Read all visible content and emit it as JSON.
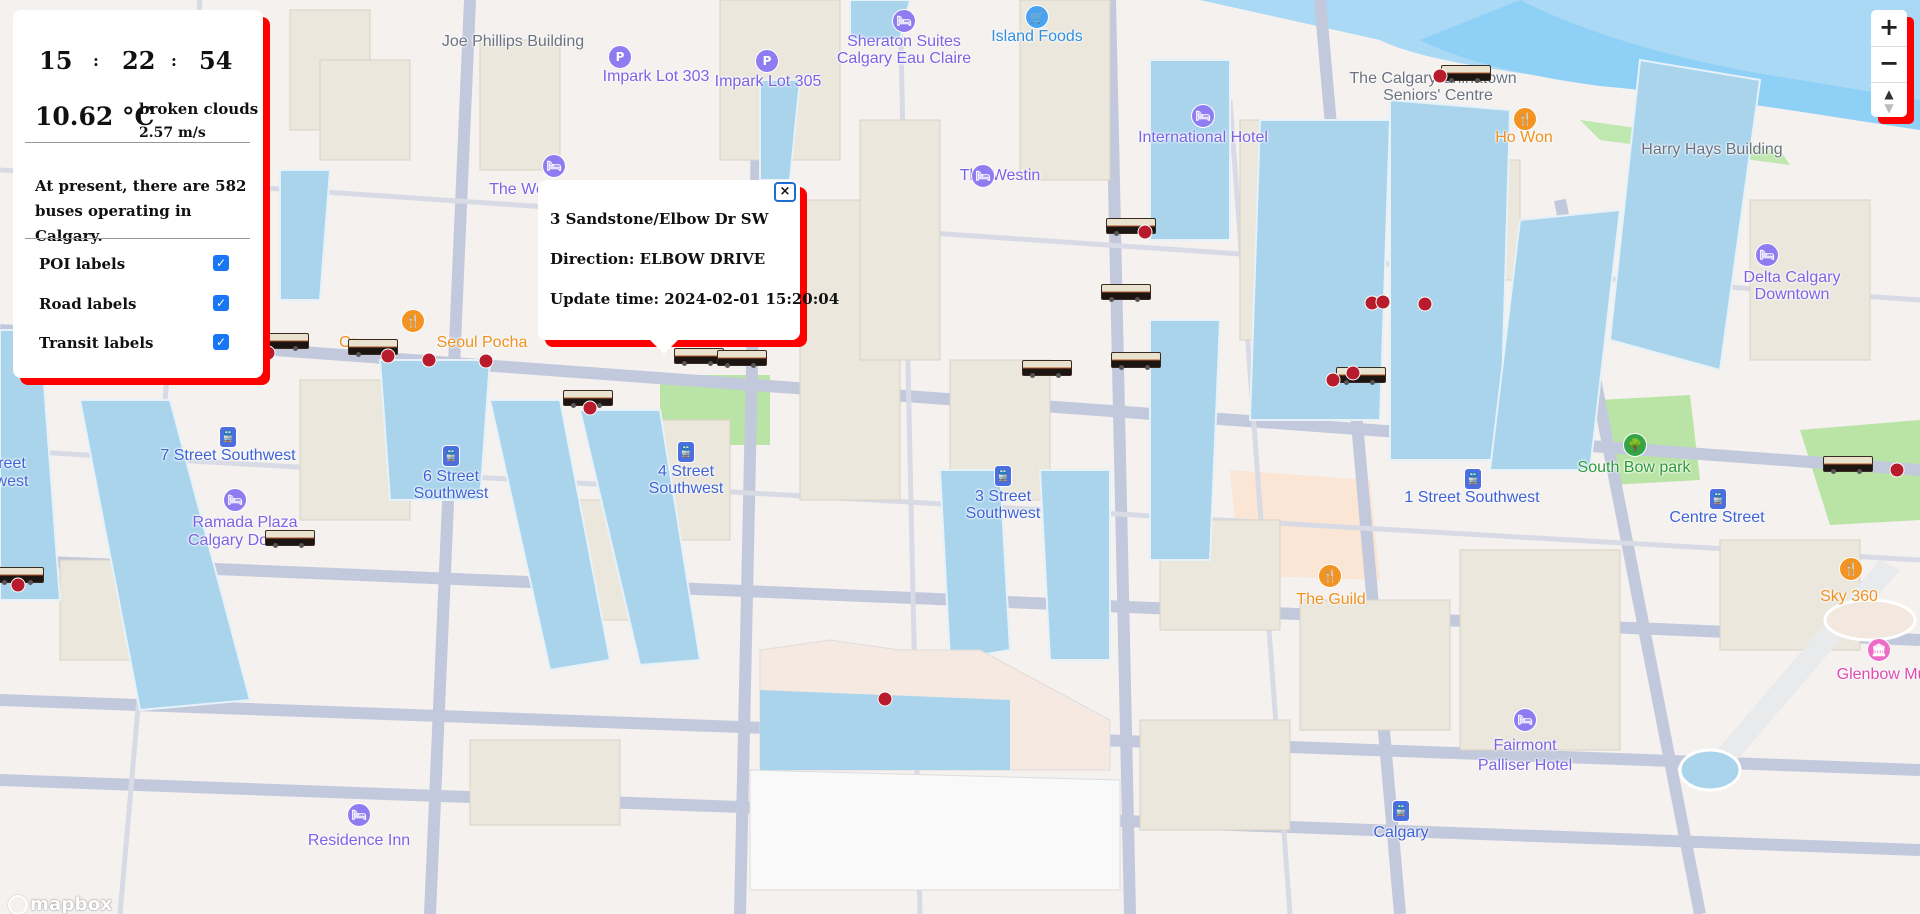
{
  "panel": {
    "clock": {
      "hours": "15",
      "minutes": "22",
      "seconds": "54",
      "separator": ":"
    },
    "weather": {
      "temperature": "10.62 °C",
      "condition": "broken clouds",
      "wind": "2.57 m/s"
    },
    "bus_summary": "At present, there are 582 buses operating in Calgary.",
    "options": [
      {
        "label": "POI labels",
        "checked": true,
        "check_glyph": "✓"
      },
      {
        "label": "Road labels",
        "checked": true,
        "check_glyph": "✓"
      },
      {
        "label": "Transit labels",
        "checked": true,
        "check_glyph": "✓"
      }
    ],
    "accent_shadow_color": "#ff0000"
  },
  "popup": {
    "close_glyph": "×",
    "route": "3 Sandstone/Elbow Dr SW",
    "direction": "Direction: ELBOW DRIVE",
    "update_time": "Update time: 2024-02-01 15:20:04"
  },
  "controls": {
    "zoom_in": "+",
    "zoom_out": "−",
    "compass_north": "▲",
    "compass_south": "▼"
  },
  "attribution": {
    "text": "mapbox"
  },
  "map_labels": [
    {
      "text": "Joe Phillips Building",
      "type": "building"
    },
    {
      "text": "Impark Lot 303",
      "type": "parking"
    },
    {
      "text": "Impark Lot 305",
      "type": "parking"
    },
    {
      "text": "Sheraton Suites",
      "type": "hotel"
    },
    {
      "text": "Calgary Eau Claire",
      "type": "hotel"
    },
    {
      "text": "Island Foods",
      "type": "shop"
    },
    {
      "text": "The Calgary Chinatown",
      "type": "building"
    },
    {
      "text": "Seniors' Centre",
      "type": "building"
    },
    {
      "text": "International Hotel",
      "type": "hotel"
    },
    {
      "text": "Ho Won",
      "type": "food"
    },
    {
      "text": "Harry Hays Building",
      "type": "building"
    },
    {
      "text": "The Westin",
      "type": "hotel"
    },
    {
      "text": "The We",
      "type": "hotel"
    },
    {
      "text": "Delta Calgary",
      "type": "hotel"
    },
    {
      "text": "Downtown",
      "type": "hotel"
    },
    {
      "text": "Seoul Pocha",
      "type": "food"
    },
    {
      "text": "Or",
      "type": "food"
    },
    {
      "text": "7 Street Southwest",
      "type": "transit"
    },
    {
      "text": "6 Street",
      "type": "transit"
    },
    {
      "text": "Southwest",
      "type": "transit"
    },
    {
      "text": "4 Street",
      "type": "transit"
    },
    {
      "text": "Southwest",
      "type": "transit"
    },
    {
      "text": "3 Street",
      "type": "transit"
    },
    {
      "text": "Southwest",
      "type": "transit"
    },
    {
      "text": "1 Street Southwest",
      "type": "transit"
    },
    {
      "text": "Centre Street",
      "type": "transit"
    },
    {
      "text": "South Bow park",
      "type": "park"
    },
    {
      "text": "Ramada Plaza",
      "type": "hotel"
    },
    {
      "text": "Calgary Do",
      "type": "hotel"
    },
    {
      "text": "reet",
      "type": "transit"
    },
    {
      "text": "west",
      "type": "transit"
    },
    {
      "text": "The Guild",
      "type": "food"
    },
    {
      "text": "Sky 360",
      "type": "food"
    },
    {
      "text": "Glenbow Muse",
      "type": "museum"
    },
    {
      "text": "Fairmont",
      "type": "hotel"
    },
    {
      "text": "Palliser Hotel",
      "type": "hotel"
    },
    {
      "text": "Calgary",
      "type": "transit"
    },
    {
      "text": "Residence Inn",
      "type": "hotel"
    }
  ],
  "poi_icons": [
    {
      "type": "parking",
      "glyph": "P",
      "name": "parking-icon"
    },
    {
      "type": "parking",
      "glyph": "P",
      "name": "parking-icon"
    },
    {
      "type": "hotel",
      "glyph": "🛏",
      "name": "hotel-icon"
    },
    {
      "type": "shop",
      "glyph": "🛒",
      "name": "shopping-cart-icon"
    },
    {
      "type": "hotel",
      "glyph": "🛏",
      "name": "hotel-icon"
    },
    {
      "type": "food",
      "glyph": "🍴",
      "name": "restaurant-icon"
    },
    {
      "type": "hotel",
      "glyph": "🛏",
      "name": "hotel-icon"
    },
    {
      "type": "hotel",
      "glyph": "🛏",
      "name": "hotel-icon"
    },
    {
      "type": "hotel",
      "glyph": "🛏",
      "name": "hotel-icon"
    },
    {
      "type": "food",
      "glyph": "🍴",
      "name": "restaurant-icon"
    },
    {
      "type": "transit",
      "glyph": "🚆",
      "name": "train-icon"
    },
    {
      "type": "transit",
      "glyph": "🚆",
      "name": "train-icon"
    },
    {
      "type": "transit",
      "glyph": "🚆",
      "name": "train-icon"
    },
    {
      "type": "transit",
      "glyph": "🚆",
      "name": "train-icon"
    },
    {
      "type": "transit",
      "glyph": "🚆",
      "name": "train-icon"
    },
    {
      "type": "transit",
      "glyph": "🚆",
      "name": "train-icon"
    },
    {
      "type": "park",
      "glyph": "🌳",
      "name": "park-icon"
    },
    {
      "type": "hotel",
      "glyph": "🛏",
      "name": "hotel-icon"
    },
    {
      "type": "food",
      "glyph": "🍴",
      "name": "restaurant-icon"
    },
    {
      "type": "food",
      "glyph": "🍴",
      "name": "restaurant-icon"
    },
    {
      "type": "museum",
      "glyph": "🏛",
      "name": "museum-icon"
    },
    {
      "type": "hotel",
      "glyph": "🛏",
      "name": "hotel-icon"
    },
    {
      "type": "transit",
      "glyph": "🚆",
      "name": "train-icon"
    },
    {
      "type": "hotel",
      "glyph": "🛏",
      "name": "hotel-icon"
    },
    {
      "type": "transit",
      "glyph": "🚆",
      "name": "train-icon"
    }
  ]
}
